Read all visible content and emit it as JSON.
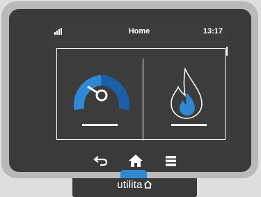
{
  "status": {
    "title": "Home",
    "time": "13:17",
    "signal_icon": "signal-bars-icon"
  },
  "tiles": {
    "electricity": {
      "icon": "speedometer-gauge-icon"
    },
    "gas": {
      "icon": "gas-flame-icon"
    }
  },
  "nav": {
    "back_icon": "back-arrow-icon",
    "home_icon": "home-icon",
    "menu_icon": "menu-icon"
  },
  "brand": {
    "name": "utilita"
  },
  "colors": {
    "accent_blue": "#2e88d6",
    "dark_blue": "#1a5fa8",
    "screen_bg": "#3c3c3c",
    "device_frame": "#b9b9b9"
  }
}
